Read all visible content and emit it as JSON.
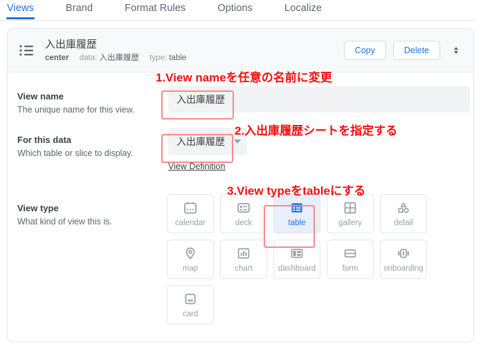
{
  "tabs": [
    {
      "label": "Views",
      "active": true
    },
    {
      "label": "Brand",
      "active": false
    },
    {
      "label": "Format Rules",
      "active": false
    },
    {
      "label": "Options",
      "active": false
    },
    {
      "label": "Localize",
      "active": false
    }
  ],
  "card": {
    "icon": "list-view-icon",
    "title": "入出庫履歴",
    "subtitle": {
      "owner": "center",
      "data_key": "data:",
      "data_value": "入出庫履歴",
      "type_key": "type:",
      "type_value": "table"
    },
    "buttons": {
      "copy": "Copy",
      "delete": "Delete",
      "expand_icon": "expand-collapse-icon"
    }
  },
  "fields": {
    "view_name": {
      "label": "View name",
      "description": "The unique name for this view.",
      "value": "入出庫履歴",
      "placeholder": ""
    },
    "for_this_data": {
      "label": "For this data",
      "description": "Which table or slice to display.",
      "value": "入出庫履歴",
      "link": "View Definition",
      "caret_icon": "chevron-down-icon"
    },
    "view_type": {
      "label": "View type",
      "description": "What kind of view this is.",
      "selected": "table",
      "rows": [
        [
          {
            "name": "calendar",
            "icon": "calendar-icon"
          },
          {
            "name": "deck",
            "icon": "deck-icon"
          },
          {
            "name": "table",
            "icon": "table-icon"
          },
          {
            "name": "gallery",
            "icon": "gallery-icon"
          },
          {
            "name": "detail",
            "icon": "detail-shapes-icon"
          }
        ],
        [
          {
            "name": "map",
            "icon": "map-pin-icon"
          },
          {
            "name": "chart",
            "icon": "bar-chart-icon"
          },
          {
            "name": "dashboard",
            "icon": "dashboard-layout-icon"
          },
          {
            "name": "form",
            "icon": "form-rows-icon"
          },
          {
            "name": "onboarding",
            "icon": "onboarding-carousel-icon"
          }
        ],
        [
          {
            "name": "card",
            "icon": "card-image-icon"
          }
        ]
      ]
    }
  },
  "annotations": [
    {
      "id": "step1",
      "text": "1.View nameを任意の名前に変更"
    },
    {
      "id": "step2",
      "text": "2.入出庫履歴シートを指定する"
    },
    {
      "id": "step3",
      "text": "3.View typeをtableにする"
    }
  ],
  "colors": {
    "accent": "#1a73e8",
    "annotation": "#fb0d0d",
    "highlight_border": "#f88a8a",
    "selected_tile_bg": "#e8eefc",
    "field_bg": "#f1f3f4"
  }
}
